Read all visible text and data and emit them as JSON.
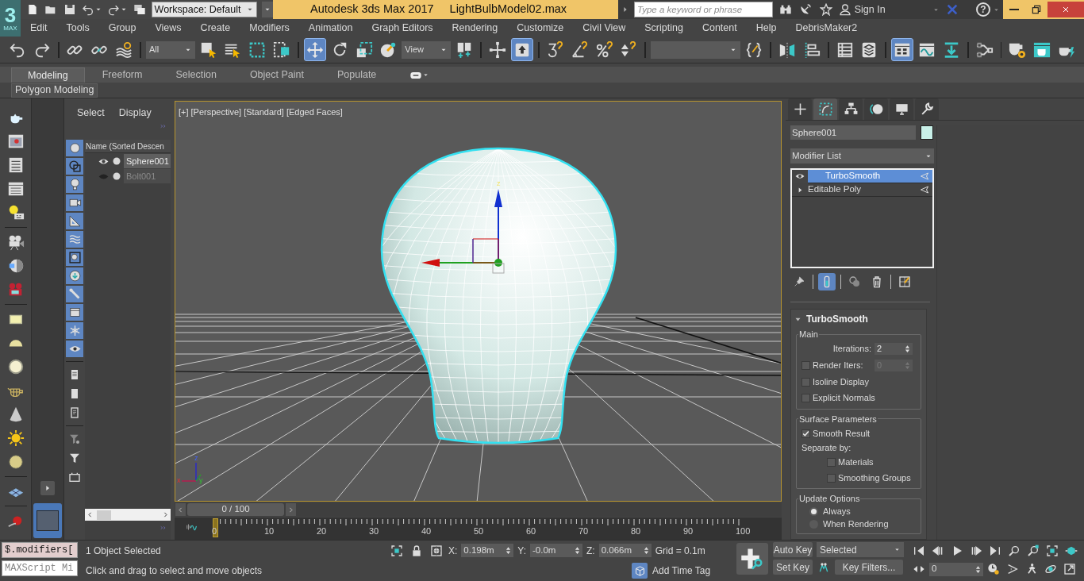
{
  "app": {
    "logo_numeral": "3",
    "logo_label": "MAX",
    "workspace": "Workspace: Default",
    "title": "Autodesk 3ds Max 2017",
    "file": "LightBulbModel02.max",
    "search_placeholder": "Type a keyword or phrase",
    "sign_in": "Sign In",
    "help": "?"
  },
  "menu": [
    "Edit",
    "Tools",
    "Group",
    "Views",
    "Create",
    "Modifiers",
    "Animation",
    "Graph Editors",
    "Rendering",
    "Customize",
    "Civil View",
    "Scripting",
    "Content",
    "Help",
    "DebrisMaker2"
  ],
  "toolbar": {
    "selection_filter": "All",
    "reference_coordinate": "View",
    "buttons": [
      {
        "selected": false
      },
      {
        "selected": false
      },
      {
        "selected": false
      },
      {
        "selected": false
      },
      {
        "selected": false
      },
      {
        "selected": false
      },
      {
        "selected": false
      },
      {
        "selected": false
      },
      {
        "selected": false
      },
      {
        "selected": true
      },
      {
        "selected": false
      },
      {
        "selected": false
      },
      {
        "selected": false
      },
      {
        "selected": false
      },
      {
        "selected": false
      },
      {
        "selected": true
      },
      {
        "selected": false
      },
      {
        "selected": false
      },
      {
        "selected": false
      },
      {
        "selected": false
      },
      {
        "selected": false
      },
      {
        "selected": false
      },
      {
        "selected": false
      },
      {
        "selected": false
      },
      {
        "selected": false
      },
      {
        "selected": true
      },
      {
        "selected": false
      },
      {
        "selected": false
      },
      {
        "selected": false
      },
      {
        "selected": false
      },
      {
        "selected": false
      },
      {
        "selected": false
      }
    ]
  },
  "ribbon": {
    "tabs": [
      {
        "label": "Modeling",
        "selected": true
      },
      {
        "label": "Freeform",
        "selected": false
      },
      {
        "label": "Selection",
        "selected": false
      },
      {
        "label": "Object Paint",
        "selected": false
      },
      {
        "label": "Populate",
        "selected": false
      }
    ],
    "panel": "Polygon Modeling"
  },
  "scene_explorer": {
    "tabs": [
      "Select",
      "Display"
    ],
    "column": "Name (Sorted Descen",
    "filters": [
      {
        "on": true
      },
      {
        "on": true
      },
      {
        "on": true
      },
      {
        "on": true
      },
      {
        "on": true
      },
      {
        "on": true
      },
      {
        "on": true
      },
      {
        "on": true
      },
      {
        "on": true
      },
      {
        "on": true
      },
      {
        "on": true
      },
      {
        "on": true
      }
    ],
    "objects": [
      {
        "name": "Sphere001",
        "selected": true,
        "visible": true
      },
      {
        "name": "Bolt001",
        "selected": false,
        "visible": false
      }
    ]
  },
  "viewport": {
    "labels": [
      "[+]",
      "[Perspective]",
      "[Standard]",
      "[Edged Faces]"
    ],
    "gizmo_label": "z",
    "axis_labels": [
      "x",
      "y",
      "z"
    ]
  },
  "command_panel": {
    "tabs": [
      {
        "selected": false
      },
      {
        "selected": true
      },
      {
        "selected": false
      },
      {
        "selected": false
      },
      {
        "selected": false
      },
      {
        "selected": false
      }
    ],
    "object_name": "Sphere001",
    "modifier_list": "Modifier List",
    "stack": [
      {
        "name": "TurboSmooth",
        "kind": "modifier",
        "selected": true
      },
      {
        "name": "Editable Poly",
        "kind": "base",
        "selected": false
      }
    ],
    "stack_tools": [
      {
        "selected": false
      },
      {
        "selected": true
      },
      {
        "selected": false
      },
      {
        "selected": false
      },
      {
        "selected": false
      }
    ],
    "rollout": {
      "title": "TurboSmooth",
      "expanded": true,
      "groups": [
        {
          "title": "Main",
          "controls": [
            {
              "kind": "spinner",
              "label": "Iterations:",
              "value": "2",
              "disabled": false
            },
            {
              "kind": "check_spinner",
              "label": "Render Iters:",
              "checked": false,
              "value": "0",
              "disabled": true
            },
            {
              "kind": "checkbox",
              "label": "Isoline Display",
              "checked": false
            },
            {
              "kind": "checkbox",
              "label": "Explicit Normals",
              "checked": false
            }
          ]
        },
        {
          "title": "Surface Parameters",
          "controls": [
            {
              "kind": "checkbox",
              "label": "Smooth Result",
              "checked": true
            },
            {
              "kind": "label",
              "label": "Separate by:",
              "children": [
                {
                  "kind": "checkbox",
                  "label": "Materials",
                  "checked": false
                },
                {
                  "kind": "checkbox",
                  "label": "Smoothing Groups",
                  "checked": false
                }
              ]
            }
          ]
        },
        {
          "title": "Update Options",
          "controls": [
            {
              "kind": "radio",
              "label": "Always",
              "selected": true
            },
            {
              "kind": "radio",
              "label": "When Rendering",
              "selected": false
            }
          ]
        }
      ]
    }
  },
  "time_slider": {
    "position": "0 / 100",
    "level": 0,
    "ticks": [
      "0",
      "10",
      "20",
      "30",
      "40",
      "50",
      "60",
      "70",
      "80",
      "90",
      "100"
    ]
  },
  "status_bar": {
    "script_listener": "$.modifiers[",
    "mini_listener_placeholder": "MAXScript Mi",
    "selection": "1 Object Selected",
    "prompt": "Click and drag to select and move objects",
    "x_label": "X:",
    "x": "0.198m",
    "y_label": "Y:",
    "y": "-0.0m",
    "z_label": "Z:",
    "z": "0.066m",
    "grid": "Grid = 0.1m",
    "time_tag": "Add Time Tag",
    "auto_key": "Auto Key",
    "set_key": "Set Key",
    "key_mode": "Selected",
    "key_filters": "Key Filters...",
    "frame": "0"
  }
}
